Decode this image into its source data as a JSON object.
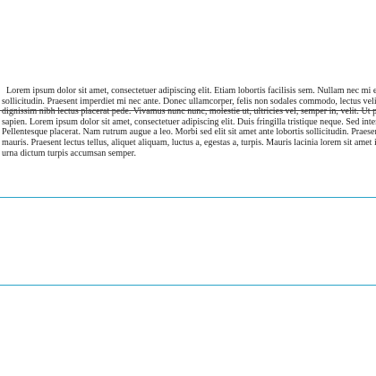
{
  "document": {
    "paragraph_lines": [
      "Lorem ipsum dolor sit amet, consectetuer adipiscing elit.  Etiam lobortis facilisis sem.  Nullam nec mi et neque pharetra",
      "sollicitudin.  Praesent imperdiet mi nec ante.  Donec ullamcorper, felis non sodales commodo, lectus velit ultrices augue, a",
      "dignissim nibh lectus placerat pede. Vivamus nunc nunc, molestie ut, ultricies vel, semper in, velit. Ut porttitor. Praesent in",
      "sapien. Lorem ipsum dolor sit amet, consectetuer adipiscing elit. Duis fringilla tristique neque. Sed interdum libero ut metus.",
      "Pellentesque placerat. Nam rutrum augue a leo. Morbi sed elit sit amet ante lobortis sollicitudin. Praesent blandit blandit",
      "mauris. Praesent lectus tellus, aliquet aliquam, luctus a, egestas a, turpis. Mauris lacinia lorem sit amet ipsum. Nunc quis",
      "urna dictum turpis accumsan semper."
    ]
  },
  "colors": {
    "text": "#222222",
    "underline_rule": "#4a4a4a",
    "blue_rule": "#2aa4c8"
  }
}
